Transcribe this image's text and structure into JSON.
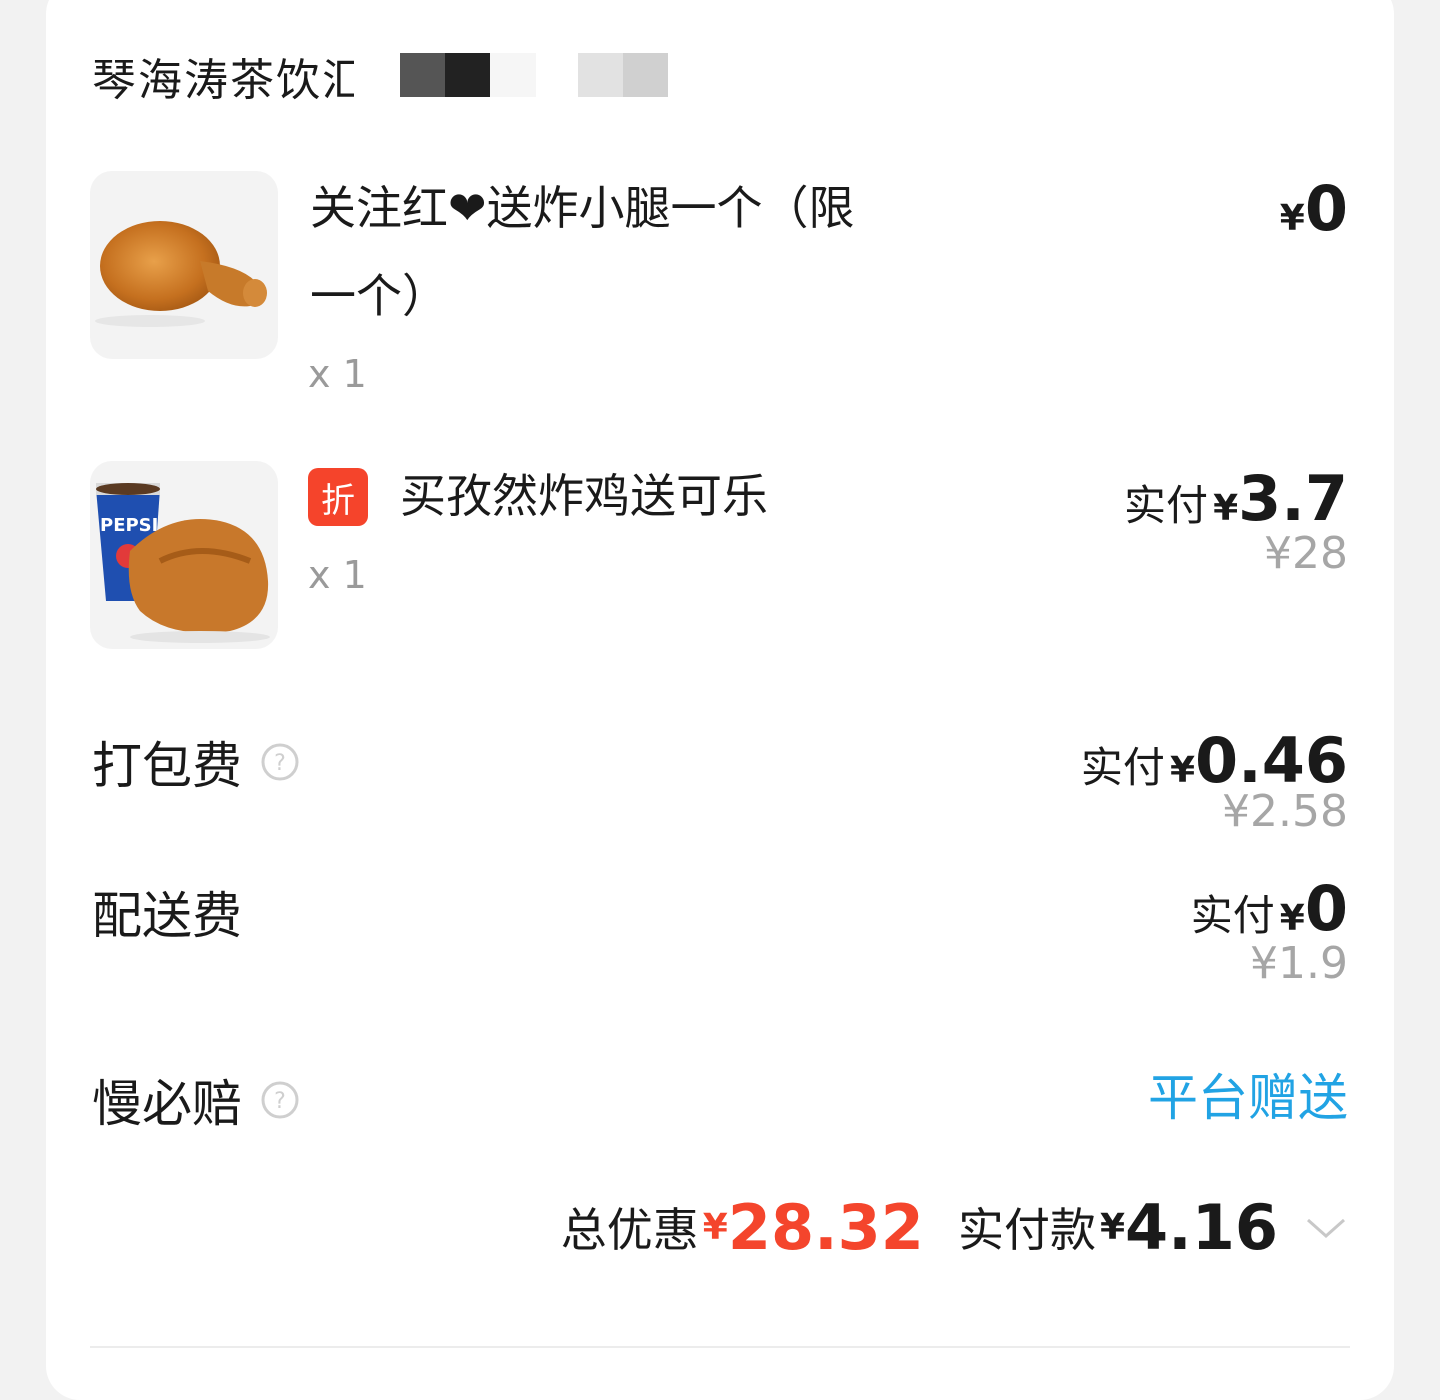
{
  "store": {
    "name": "琴海涛茶饮汇"
  },
  "items": [
    {
      "title_line1": "关注红❤送炸小腿一个（限",
      "title_line2": "一个）",
      "qty": "x 1",
      "yen": "¥",
      "price": "0",
      "image_icon": "fried-drumstick-image"
    },
    {
      "badge": "折",
      "title": "买孜然炸鸡送可乐",
      "qty": "x 1",
      "paid_label": "实付",
      "yen": "¥",
      "price": "3.7",
      "original_price": "¥28",
      "image_icon": "fried-chicken-pepsi-image"
    }
  ],
  "fees": {
    "packing": {
      "label": "打包费",
      "paid_label": "实付",
      "yen": "¥",
      "price": "0.46",
      "original_price": "¥2.58"
    },
    "delivery": {
      "label": "配送费",
      "paid_label": "实付",
      "yen": "¥",
      "price": "0",
      "original_price": "¥1.9"
    },
    "late_compensation": {
      "label": "慢必赔",
      "value": "平台赠送"
    }
  },
  "summary": {
    "discount_label": "总优惠",
    "discount_yen": "¥",
    "discount_value": "28.32",
    "paid_label": "实付款",
    "paid_yen": "¥",
    "paid_value": "4.16"
  },
  "colors": {
    "accent_red": "#f4452c",
    "link_blue": "#21a3e4",
    "muted": "#a6a6a6"
  }
}
